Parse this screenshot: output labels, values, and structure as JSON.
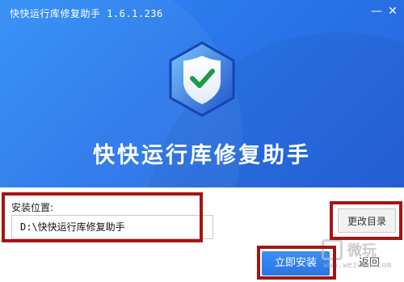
{
  "window": {
    "title": "快快运行库修复助手 1.6.1.236",
    "minimize_icon": "minimize-icon",
    "close_icon": "close-icon"
  },
  "banner": {
    "app_name": "快快运行库修复助手",
    "logo_icon": "shield-check-icon",
    "background_color": "#2a76ea"
  },
  "install": {
    "label": "安装位置:",
    "path_value": "D:\\快快运行库修复助手",
    "change_button": "更改目录",
    "install_button": "立即安装",
    "back_button": "返回"
  },
  "watermark": {
    "text": "微玩",
    "url": "www.weiwan.com"
  },
  "colors": {
    "accent": "#2b74e2",
    "highlight_border": "#a31515"
  }
}
